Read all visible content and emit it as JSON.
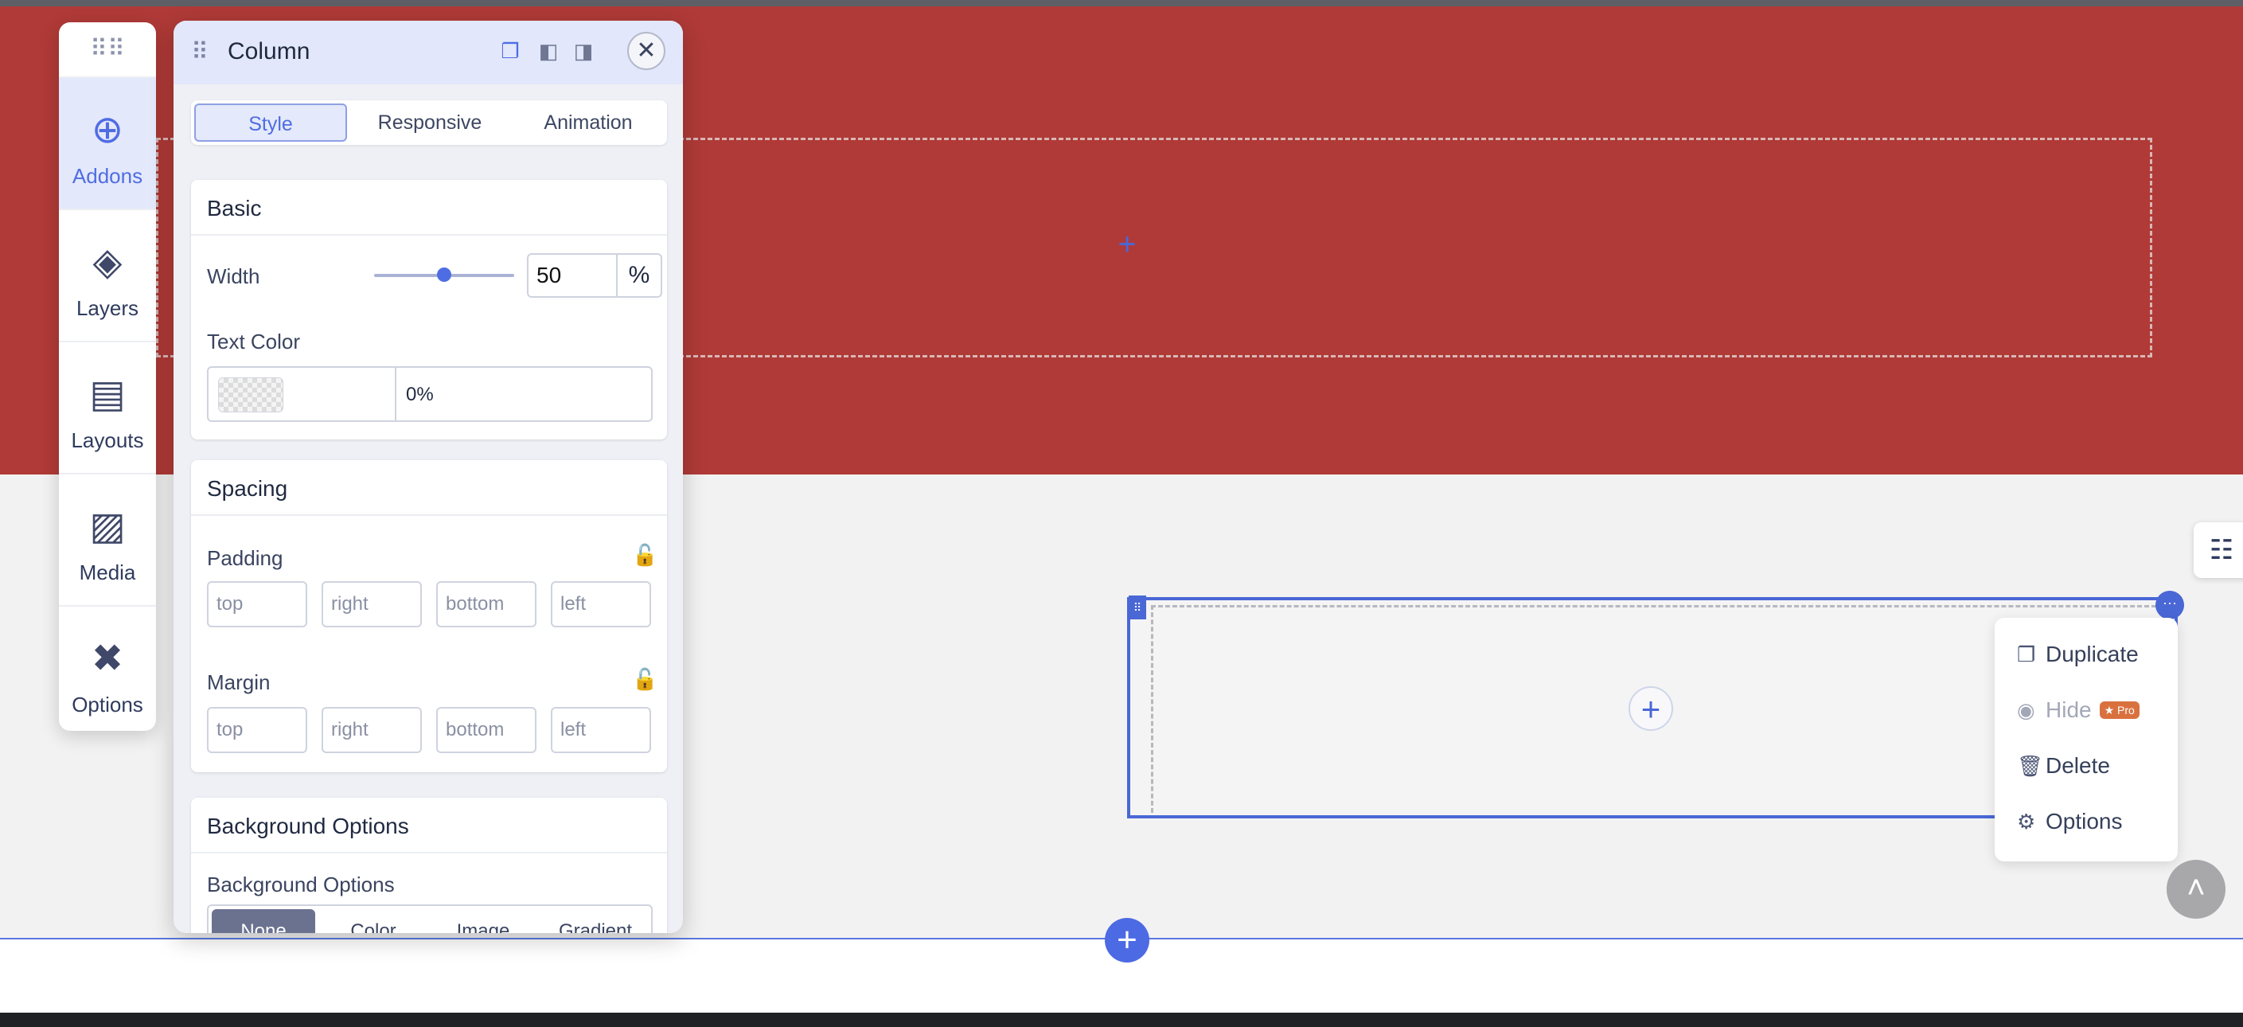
{
  "sidebar": {
    "items": [
      {
        "label": "Addons",
        "icon": "plus-circle-icon",
        "active": true
      },
      {
        "label": "Layers",
        "icon": "layers-icon"
      },
      {
        "label": "Layouts",
        "icon": "layout-icon"
      },
      {
        "label": "Media",
        "icon": "media-icon"
      },
      {
        "label": "Options",
        "icon": "tools-icon"
      }
    ]
  },
  "panel": {
    "title": "Column",
    "tabs": [
      "Style",
      "Responsive",
      "Animation"
    ],
    "active_tab": "Style",
    "basic": {
      "title": "Basic",
      "width_label": "Width",
      "width_value": "50",
      "width_unit": "%",
      "width_fraction": 0.5,
      "text_color_label": "Text Color",
      "text_color_value": "0%"
    },
    "spacing": {
      "title": "Spacing",
      "padding_label": "Padding",
      "margin_label": "Margin",
      "placeholders": [
        "top",
        "right",
        "bottom",
        "left"
      ]
    },
    "background": {
      "title": "Background Options",
      "label": "Background Options",
      "options": [
        "None",
        "Color",
        "Image",
        "Gradient"
      ],
      "selected": "None"
    }
  },
  "context_menu": {
    "items": [
      {
        "label": "Duplicate",
        "icon": "copy-icon"
      },
      {
        "label": "Hide",
        "icon": "eye-icon",
        "badge": "Pro",
        "disabled": true
      },
      {
        "label": "Delete",
        "icon": "trash-icon"
      },
      {
        "label": "Options",
        "icon": "gear-icon"
      }
    ]
  },
  "colors": {
    "top_section": "#b03a37",
    "accent": "#4f6de3",
    "pro_badge": "#d9713f"
  }
}
